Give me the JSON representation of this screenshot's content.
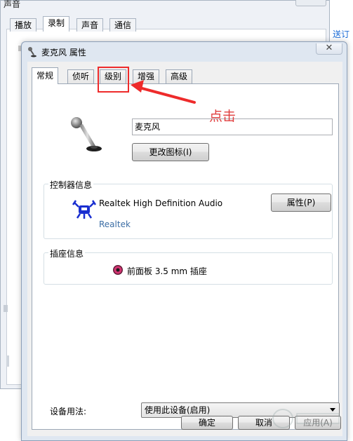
{
  "background_window": {
    "title": "声音",
    "tabs": [
      "播放",
      "录制",
      "声音",
      "通信"
    ],
    "side_link": "送订"
  },
  "dialog": {
    "title": "麦克风 属性",
    "close_symbol": "✕",
    "tabs": [
      "常规",
      "侦听",
      "级别",
      "增强",
      "高级"
    ],
    "active_tab": "常规",
    "device_name": "麦克风",
    "change_icon_button": "更改图标(I)",
    "controller_group": {
      "label": "控制器信息",
      "name": "Realtek High Definition Audio",
      "vendor_link": "Realtek",
      "properties_button": "属性(P)"
    },
    "jack_group": {
      "label": "插座信息",
      "jack": "前面板 3.5 mm 插座"
    },
    "usage": {
      "label": "设备用法:",
      "selected": "使用此设备(启用)"
    },
    "buttons": {
      "ok": "确定",
      "cancel": "取消",
      "apply": "应用(A)"
    }
  },
  "annotation": {
    "text": "点击",
    "color": "#ee2b2b"
  },
  "icons": {
    "title_icon": "microphone-icon",
    "device_icon": "microphone-icon",
    "controller_logo": "realtek-crab-logo",
    "jack_icon": "jack-pink-icon"
  },
  "colors": {
    "dialog_frame": "#dfe7f1",
    "link": "#3c6ea5",
    "annotation": "#e03f3f"
  }
}
